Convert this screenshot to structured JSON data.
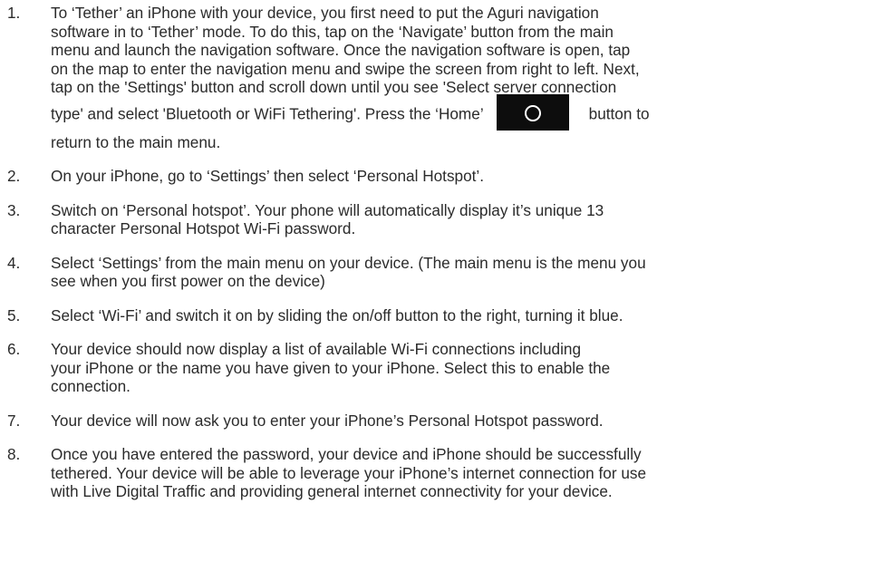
{
  "steps": [
    {
      "num": "1.",
      "lines": [
        "To ‘Tether’ an iPhone with your device, you first need to put the Aguri navigation",
        "software in to ‘Tether’ mode. To do this, tap on the ‘Navigate’ button from the main",
        "menu and launch the navigation software. Once the navigation software is open, tap",
        "on the map to enter the navigation menu and swipe the screen from right to left. Next,",
        "tap on the 'Settings' button and scroll down until you see 'Select server connection"
      ],
      "line_before_icon": "type' and select 'Bluetooth or WiFi Tethering'. Press the ‘Home’",
      "icon": "home-button-icon",
      "line_after_icon": "button to",
      "last_line": "return to the main menu."
    },
    {
      "num": "2.",
      "lines": [
        "On your iPhone, go to ‘Settings’ then select ‘Personal Hotspot’."
      ]
    },
    {
      "num": "3.",
      "lines": [
        "Switch on ‘Personal hotspot’. Your phone will automatically display it’s unique 13",
        "character Personal Hotspot Wi-Fi password."
      ]
    },
    {
      "num": "4.",
      "lines": [
        "Select ‘Settings’ from the main menu on your device. (The main menu is the menu you",
        "see when you first power on the device)"
      ]
    },
    {
      "num": "5.",
      "lines": [
        "Select ‘Wi-Fi’ and switch it on by sliding the on/off button to the right, turning it blue."
      ]
    },
    {
      "num": "6.",
      "lines": [
        "Your device should now display a list of available Wi-Fi connections including",
        "your iPhone or the name you have given to your iPhone. Select this to enable the",
        "connection."
      ]
    },
    {
      "num": "7.",
      "lines": [
        "Your device will now ask you to enter your iPhone’s Personal Hotspot password."
      ]
    },
    {
      "num": "8.",
      "lines": [
        "Once you have entered the password, your device and iPhone should be successfully",
        "tethered. Your device will be able to leverage your iPhone’s internet connection for use",
        "with Live Digital Traffic and providing general internet connectivity for your device."
      ]
    }
  ]
}
